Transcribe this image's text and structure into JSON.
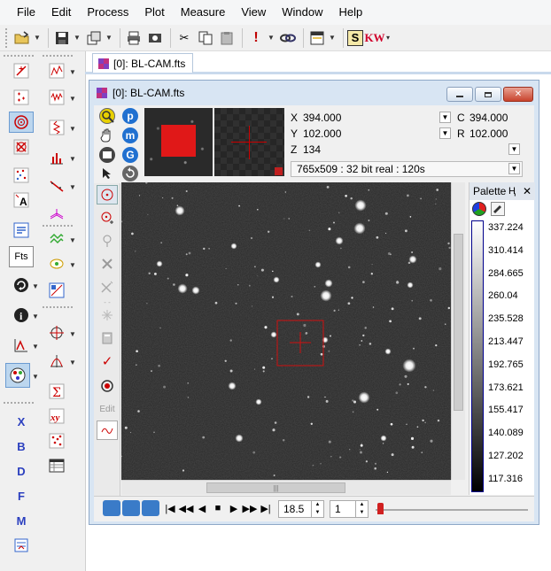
{
  "menu": [
    "File",
    "Edit",
    "Process",
    "Plot",
    "Measure",
    "View",
    "Window",
    "Help"
  ],
  "toolbar_icons": [
    "open-icon",
    "save-icon",
    "copy-window-icon",
    "print-icon",
    "print-preview-icon",
    "cut-icon",
    "copy-icon",
    "paste-icon",
    "alert-icon",
    "link-icon",
    "window-layout-icon",
    "script-icon",
    "keyword-icon"
  ],
  "toolbar_text": {
    "script": "S",
    "keyword": "KW"
  },
  "left_tools": {
    "fits": "Fts",
    "letters": [
      "X",
      "B",
      "D",
      "F",
      "M"
    ]
  },
  "doc_tab": {
    "label": "[0]: BL-CAM.fts"
  },
  "window": {
    "title": "[0]: BL-CAM.fts",
    "nav_letters": {
      "p": "p",
      "m": "m",
      "g": "G"
    },
    "coords": {
      "x_label": "X",
      "x_value": "394.000",
      "y_label": "Y",
      "y_value": "102.000",
      "z_label": "Z",
      "z_value": "134",
      "c_label": "C",
      "c_value": "394.000",
      "r_label": "R",
      "r_value": "102.000"
    },
    "image_info": "765x509 : 32 bit real : 120s",
    "edit_label": "Edit"
  },
  "palette": {
    "title": "Palette",
    "pin": "Ⱨ",
    "labels": [
      "337.224",
      "310.414",
      "284.665",
      "260.04",
      "235.528",
      "213.447",
      "192.765",
      "173.621",
      "155.417",
      "140.089",
      "127.202",
      "117.316"
    ]
  },
  "navigation": {
    "zoom_value": "18.5",
    "frame_value": "1"
  },
  "colors": {
    "window_frame": "#d8e5f3",
    "marker": "#cc0000",
    "palette_bar_border": "#00008b"
  }
}
